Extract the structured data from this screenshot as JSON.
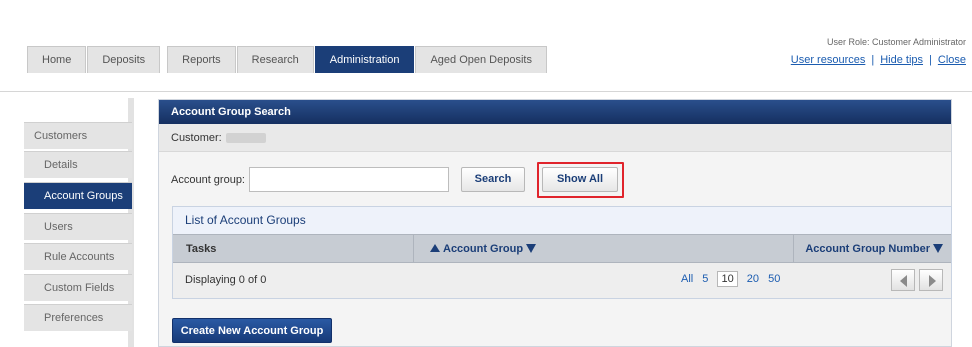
{
  "nav": {
    "tabs": [
      {
        "label": "Home"
      },
      {
        "label": "Deposits"
      },
      {
        "label": "Reports"
      },
      {
        "label": "Research"
      },
      {
        "label": "Administration"
      },
      {
        "label": "Aged Open Deposits"
      }
    ],
    "user_role": "User Role: Customer Administrator",
    "links": [
      "User resources",
      "Hide tips",
      "Close"
    ]
  },
  "sidebar": {
    "items": [
      {
        "label": "Customers"
      },
      {
        "label": "Details"
      },
      {
        "label": "Account Groups"
      },
      {
        "label": "Users"
      },
      {
        "label": "Rule Accounts"
      },
      {
        "label": "Custom Fields"
      },
      {
        "label": "Preferences"
      }
    ]
  },
  "panel": {
    "title": "Account Group Search",
    "customer_label": "Customer:",
    "account_group_label": "Account group:",
    "account_group_value": "",
    "search_button": "Search",
    "show_all_button": "Show All",
    "list": {
      "title": "List of Account Groups",
      "columns": [
        "Tasks",
        "Account Group",
        "Account Group Number"
      ],
      "displaying": "Displaying 0 of 0",
      "page_sizes": [
        "All",
        "5",
        "10",
        "20",
        "50"
      ],
      "page_size_selected": "10"
    },
    "create_button": "Create New Account Group"
  },
  "colors": {
    "accent": "#1b3e78",
    "highlight": "#e0242c",
    "link": "#1b5cb0"
  }
}
